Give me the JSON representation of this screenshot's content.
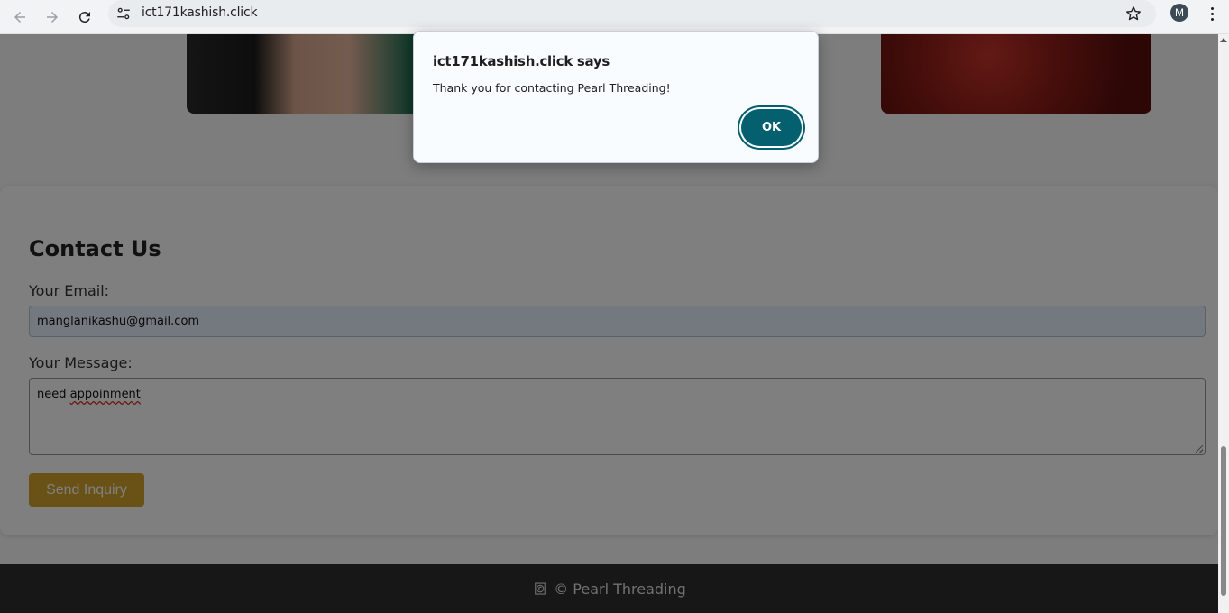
{
  "browser": {
    "url": "ict171kashish.click",
    "profile_initial": "M",
    "icons": [
      "back-icon",
      "forward-icon",
      "reload-icon",
      "site-info-icon",
      "star-icon",
      "menu-icon"
    ]
  },
  "page": {
    "contact": {
      "title": "Contact Us",
      "email_label": "Your Email:",
      "email_value": "manglanikashu@gmail.com",
      "message_label": "Your Message:",
      "message_word1": "need ",
      "message_word2": "appoinment",
      "send_button": "Send Inquiry"
    },
    "footer": {
      "text": "© Pearl Threading"
    }
  },
  "dialog": {
    "title": "ict171kashish.click says",
    "message": "Thank you for contacting Pearl Threading!",
    "ok_label": "OK"
  },
  "colors": {
    "accent": "#d4a52c",
    "dialog_button": "#045f6e",
    "footer_bg": "#2e2e2e"
  }
}
